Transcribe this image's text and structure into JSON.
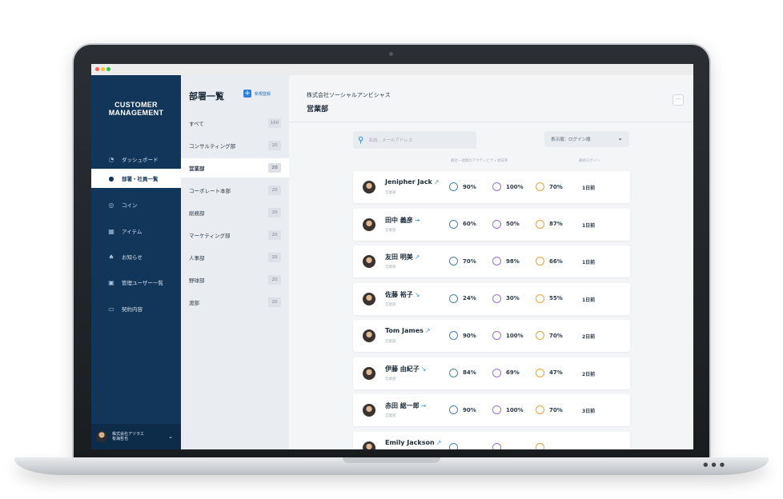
{
  "colors": {
    "sidebar": "#12365a",
    "accent": "#2f80d6",
    "ring_blue": "#4a7fb5",
    "ring_purple": "#9a6fd6",
    "ring_orange": "#e6a23c"
  },
  "sidebar": {
    "brand_line1": "CUSTOMER",
    "brand_line2": "MANAGEMENT",
    "items": [
      {
        "label": "ダッシュボード",
        "icon": "dashboard-icon"
      },
      {
        "label": "部署・社員一覧",
        "icon": "user-icon"
      },
      {
        "label": "コイン",
        "icon": "coin-icon"
      },
      {
        "label": "アイテム",
        "icon": "gift-icon"
      },
      {
        "label": "お知らせ",
        "icon": "bell-icon"
      },
      {
        "label": "管理ユーザー一覧",
        "icon": "lock-icon"
      },
      {
        "label": "契約内容",
        "icon": "contract-icon"
      }
    ],
    "user_company": "株式会社アツラエ",
    "user_name": "有海哲也"
  },
  "dept": {
    "title": "部署一覧",
    "new_label": "新規登録",
    "rows": [
      {
        "name": "すべて",
        "count": "160"
      },
      {
        "name": "コンサルティング部",
        "count": "20"
      },
      {
        "name": "営業部",
        "count": "20"
      },
      {
        "name": "コーポレート本部",
        "count": "20"
      },
      {
        "name": "総務部",
        "count": "20"
      },
      {
        "name": "マーケティング部",
        "count": "20"
      },
      {
        "name": "人事部",
        "count": "20"
      },
      {
        "name": "野球部",
        "count": "20"
      },
      {
        "name": "渡部",
        "count": "20"
      }
    ]
  },
  "main": {
    "org": "株式会社ソーシャルアンビシャス",
    "dept_name": "営業部",
    "search_placeholder": "名前、メールアドレス",
    "sort_label": "表示順：ログイン順",
    "col_activity": "最近一週間のアクティビティ達成率",
    "col_login": "最終ログイン",
    "employees": [
      {
        "name": "Jenipher Jack",
        "trend": "↗",
        "dept": "営業部",
        "m1": "90%",
        "m2": "100%",
        "m3": "70%",
        "login": "1日前"
      },
      {
        "name": "田中 義彦",
        "trend": "→",
        "dept": "営業部",
        "m1": "60%",
        "m2": "50%",
        "m3": "87%",
        "login": "1日前"
      },
      {
        "name": "友田 明美",
        "trend": "↗",
        "dept": "営業部",
        "m1": "70%",
        "m2": "98%",
        "m3": "66%",
        "login": "1日前"
      },
      {
        "name": "佐藤 裕子",
        "trend": "↘",
        "dept": "営業部",
        "m1": "24%",
        "m2": "30%",
        "m3": "55%",
        "login": "1日前"
      },
      {
        "name": "Tom James",
        "trend": "↗",
        "dept": "営業部",
        "m1": "90%",
        "m2": "100%",
        "m3": "70%",
        "login": "2日前"
      },
      {
        "name": "伊藤 由紀子",
        "trend": "↘",
        "dept": "営業部",
        "m1": "84%",
        "m2": "69%",
        "m3": "47%",
        "login": "2日前"
      },
      {
        "name": "赤田 総一郎",
        "trend": "→",
        "dept": "営業部",
        "m1": "90%",
        "m2": "100%",
        "m3": "70%",
        "login": "3日前"
      },
      {
        "name": "Emily Jackson",
        "trend": "↗",
        "dept": "",
        "m1": "",
        "m2": "",
        "m3": "",
        "login": ""
      }
    ]
  }
}
